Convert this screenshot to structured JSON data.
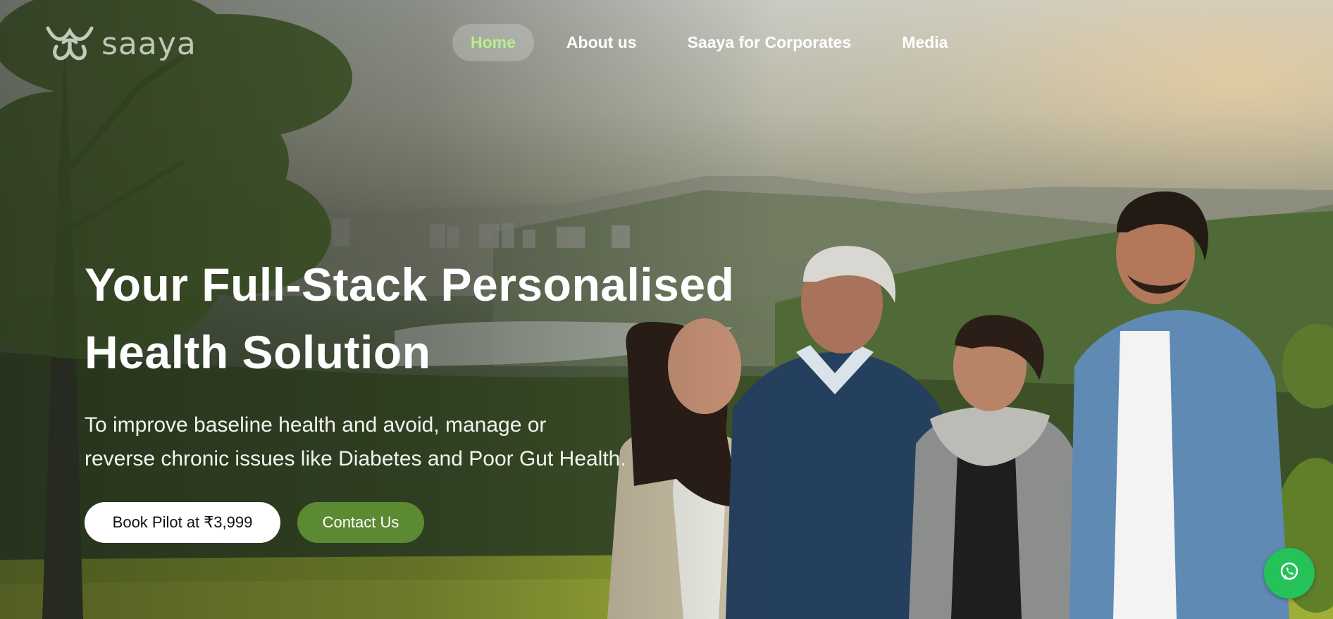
{
  "brand": {
    "name": "saaya",
    "logo_icon": "saaya-logo-icon"
  },
  "nav": {
    "items": [
      {
        "label": "Home",
        "active": true
      },
      {
        "label": "About us",
        "active": false
      },
      {
        "label": "Saaya for Corporates",
        "active": false
      },
      {
        "label": "Media",
        "active": false
      }
    ]
  },
  "hero": {
    "headline_line1": "Your Full-Stack Personalised",
    "headline_line2": "Health Solution",
    "subtitle_line1": "To improve baseline health and avoid, manage or",
    "subtitle_line2": "reverse chronic issues like Diabetes and Poor Gut Health.",
    "image_icon": "family-landscape-photo"
  },
  "buttons": {
    "book_label": "Book Pilot at ₹3,999",
    "contact_label": "Contact Us"
  },
  "floating": {
    "whatsapp_icon": "whatsapp-icon"
  },
  "colors": {
    "active_nav_text": "#b9ec8e",
    "contact_button": "#5b8a33",
    "whatsapp_green": "#25c25a"
  }
}
